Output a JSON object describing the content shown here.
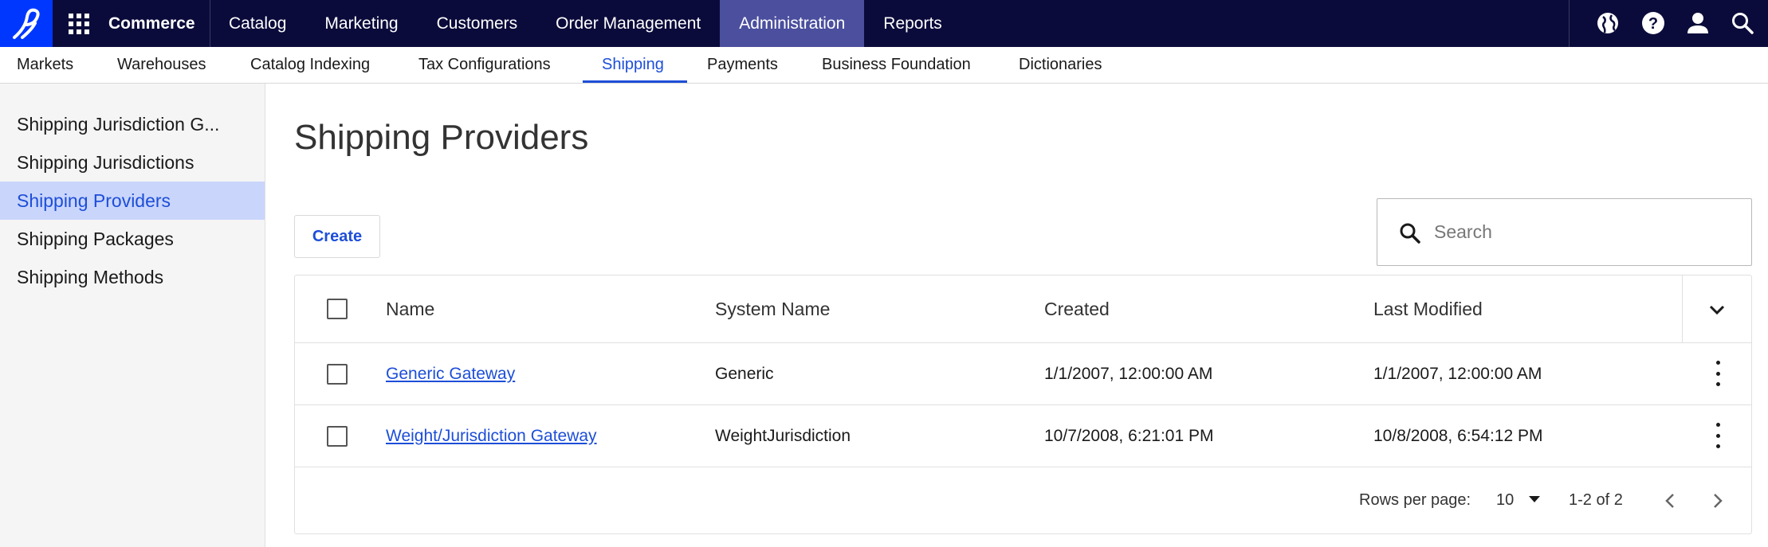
{
  "topbar": {
    "brand": "Commerce",
    "nav": [
      "Catalog",
      "Marketing",
      "Customers",
      "Order Management",
      "Administration",
      "Reports"
    ],
    "active_nav": "Administration",
    "icons": [
      "globe-icon",
      "help-icon",
      "user-icon",
      "search-icon"
    ]
  },
  "subnav": {
    "items": [
      "Markets",
      "Warehouses",
      "Catalog Indexing",
      "Tax Configurations",
      "Shipping",
      "Payments",
      "Business Foundation",
      "Dictionaries"
    ],
    "active": "Shipping"
  },
  "sidebar": {
    "items": [
      "Shipping Jurisdiction G...",
      "Shipping Jurisdictions",
      "Shipping Providers",
      "Shipping Packages",
      "Shipping Methods"
    ],
    "active": "Shipping Providers"
  },
  "main": {
    "title": "Shipping Providers",
    "create_label": "Create",
    "search_placeholder": "Search"
  },
  "table": {
    "columns": [
      "Name",
      "System Name",
      "Created",
      "Last Modified"
    ],
    "rows": [
      {
        "name": "Generic Gateway",
        "system_name": "Generic",
        "created": "1/1/2007, 12:00:00 AM",
        "modified": "1/1/2007, 12:00:00 AM"
      },
      {
        "name": "Weight/Jurisdiction Gateway",
        "system_name": "WeightJurisdiction",
        "created": "10/7/2008, 6:21:01 PM",
        "modified": "10/8/2008, 6:54:12 PM"
      }
    ],
    "footer": {
      "rows_per_page_label": "Rows per page:",
      "rows_per_page": "10",
      "range": "1-2 of 2"
    }
  },
  "colors": {
    "topbar_bg": "#0b0b3b",
    "logo_bg": "#0037ff",
    "active_nav_bg": "#4b4f9e",
    "accent": "#1d4ed8",
    "sidebar_active_bg": "#c9d5fb"
  }
}
